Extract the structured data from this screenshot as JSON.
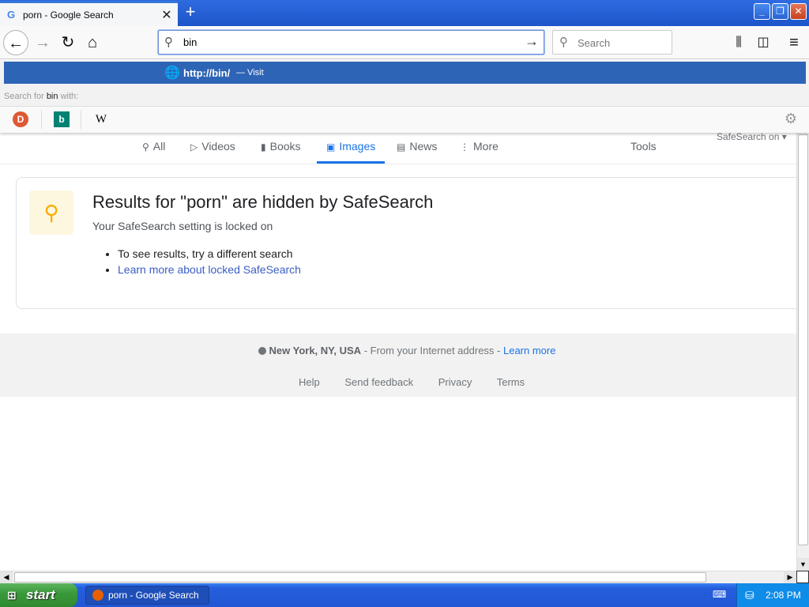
{
  "browser": {
    "tab_title": "porn - Google Search",
    "tab_favicon": "G",
    "new_tab_label": "+",
    "url_value": "bin",
    "search_placeholder": "Search"
  },
  "dropdown": {
    "visit_url": "http://bin/",
    "visit_label": "— Visit",
    "search_for_prefix": "Search for",
    "search_term": "bin",
    "search_for_suffix": "with:",
    "engines": [
      "duckduckgo-icon",
      "bing-icon",
      "wikipedia-icon"
    ],
    "wiki_glyph": "W"
  },
  "google": {
    "tabs": [
      {
        "label": "All",
        "icon": "search-icon"
      },
      {
        "label": "Videos",
        "icon": "play-icon"
      },
      {
        "label": "Books",
        "icon": "book-icon"
      },
      {
        "label": "Images",
        "icon": "image-icon"
      },
      {
        "label": "News",
        "icon": "newspaper-icon"
      },
      {
        "label": "More",
        "icon": "more-icon"
      }
    ],
    "tools_label": "Tools",
    "safesearch_label": "SafeSearch on ▾",
    "card": {
      "title": "Results for \"porn\" are hidden by SafeSearch",
      "subtitle": "Your SafeSearch setting is locked on",
      "bullet1": "To see results, try a different search",
      "bullet2": "Learn more about locked SafeSearch"
    },
    "footer": {
      "location": "New York, NY, USA",
      "location_note": " - From your Internet address - ",
      "learn_more": "Learn more",
      "links": [
        "Help",
        "Send feedback",
        "Privacy",
        "Terms"
      ]
    }
  },
  "taskbar": {
    "start_label": "start",
    "task_label": "porn - Google Search ...",
    "clock": "2:08 PM"
  },
  "colors": {
    "accent": "#1a73e8",
    "visit_row": "#2e64b6",
    "taskbar": "#245edc",
    "start": "#3a9a3a"
  }
}
